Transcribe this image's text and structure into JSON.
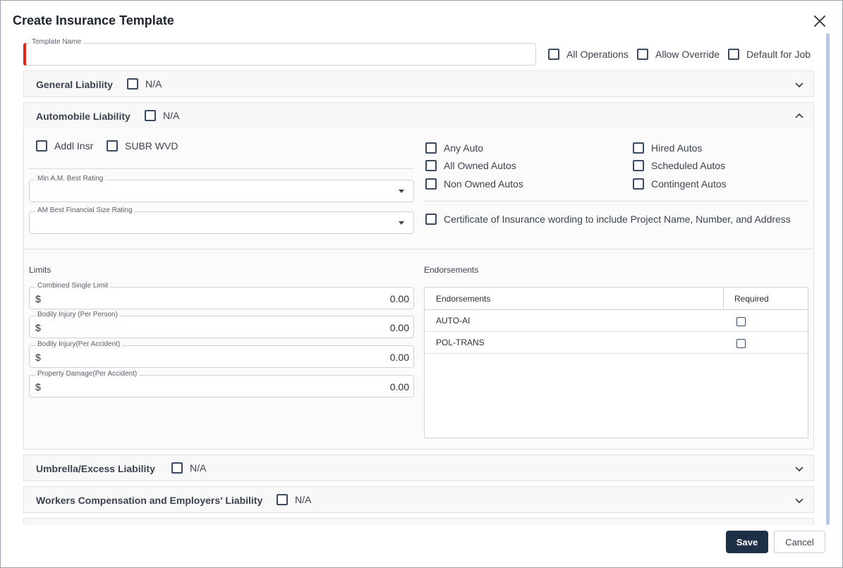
{
  "dialog": {
    "title": "Create Insurance Template",
    "close_icon": "close-icon"
  },
  "template_name": {
    "label": "Template Name",
    "value": ""
  },
  "options": {
    "all_operations": "All Operations",
    "allow_override": "Allow Override",
    "default_for_job": "Default for Job"
  },
  "sections": {
    "general_liability": {
      "title": "General Liability",
      "na": "N/A",
      "expanded": false
    },
    "automobile_liability": {
      "title": "Automobile Liability",
      "na": "N/A",
      "expanded": true
    },
    "umbrella": {
      "title": "Umbrella/Excess Liability",
      "na": "N/A",
      "expanded": false
    },
    "workers_comp": {
      "title": "Workers Compensation and Employers' Liability",
      "na": "N/A",
      "expanded": false
    }
  },
  "auto": {
    "addl_insr": "Addl Insr",
    "subr_wvd": "SUBR WVD",
    "min_am_best": {
      "label": "Min A.M. Best Rating",
      "value": ""
    },
    "am_best_size": {
      "label": "AM Best Financial Size Rating",
      "value": ""
    },
    "any_auto": "Any Auto",
    "all_owned": "All Owned Autos",
    "non_owned": "Non Owned Autos",
    "hired": "Hired Autos",
    "scheduled": "Scheduled Autos",
    "contingent": "Contingent Autos",
    "certificate": "Certificate of Insurance wording to include Project Name, Number, and Address",
    "limits_title": "Limits",
    "limits": [
      {
        "label": "Combined Single Limit",
        "currency": "$",
        "value": "0.00"
      },
      {
        "label": "Bodily Injury (Per Person)",
        "currency": "$",
        "value": "0.00"
      },
      {
        "label": "Bodily Injury(Per Accident)",
        "currency": "$",
        "value": "0.00"
      },
      {
        "label": "Property Damage(Per Accident)",
        "currency": "$",
        "value": "0.00"
      }
    ],
    "endorsements_title": "Endorsements",
    "endorsements_table": {
      "col_name": "Endorsements",
      "col_required": "Required",
      "rows": [
        {
          "name": "AUTO-AI",
          "required": false
        },
        {
          "name": "POL-TRANS",
          "required": false
        }
      ]
    }
  },
  "buttons": {
    "save": "Save",
    "cancel": "Cancel"
  },
  "colors": {
    "primary_button": "#1e3048",
    "required_marker": "#e0261c",
    "checkbox_border": "#3b4a63",
    "scrollbar": "#b6c6e6"
  }
}
